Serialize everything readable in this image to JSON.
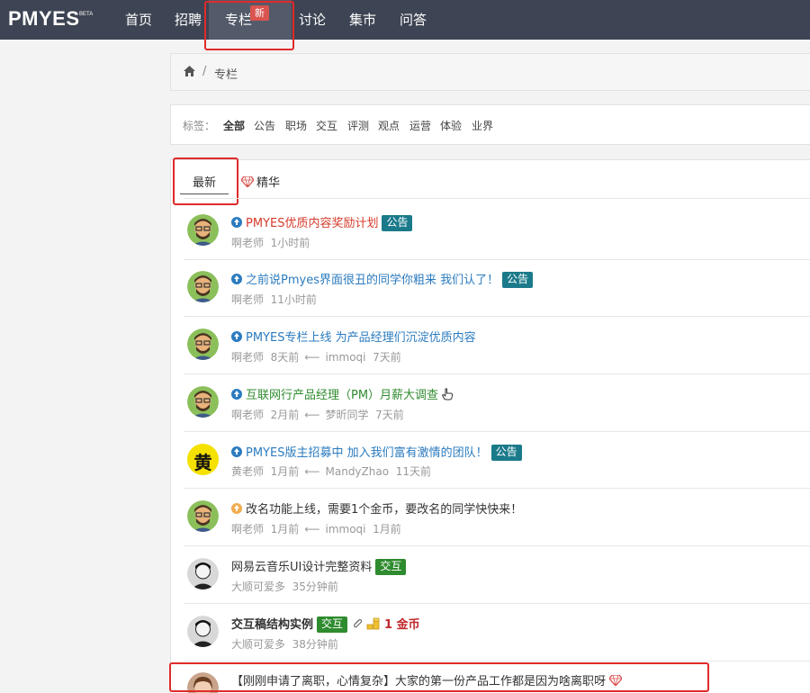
{
  "nav": {
    "logo": "PMYES",
    "logo_badge": "BETA",
    "items": [
      "首页",
      "招聘",
      "专栏",
      "讨论",
      "集市",
      "问答"
    ],
    "active": "专栏",
    "new_badge": "新"
  },
  "breadcrumb": {
    "separator": "/",
    "current": "专栏"
  },
  "tags": {
    "label": "标签：",
    "items": [
      "全部",
      "公告",
      "职场",
      "交互",
      "评测",
      "观点",
      "运营",
      "体验",
      "业界"
    ],
    "active": "全部"
  },
  "tabs": {
    "latest": "最新",
    "featured": "精华"
  },
  "colors": {
    "nav_bg": "#3d4453",
    "announce_badge": "#1a7a8a",
    "interaction_badge": "#2e8b2e",
    "highlight_box": "#e02a2a"
  },
  "posts": [
    {
      "title": "PMYES优质内容奖励计划",
      "badge": "公告",
      "author": "啊老师",
      "time": "1小时前",
      "avatar_icon": "bearded-man-avatar"
    },
    {
      "title": "之前说Pmyes界面很丑的同学你粗来 我们认了！",
      "badge": "公告",
      "author": "啊老师",
      "time": "11小时前",
      "avatar_icon": "bearded-man-avatar"
    },
    {
      "title": "PMYES专栏上线 为产品经理们沉淀优质内容",
      "author": "啊老师",
      "time": "8天前",
      "arrow": "⟵",
      "reply_author": "immoqi",
      "reply_time": "7天前",
      "avatar_icon": "bearded-man-avatar"
    },
    {
      "title": "互联网行产品经理（PM）月薪大调查",
      "author": "啊老师",
      "time": "2月前",
      "arrow": "⟵",
      "reply_author": "梦昕同学",
      "reply_time": "7天前",
      "avatar_icon": "bearded-man-avatar"
    },
    {
      "title": "PMYES版主招募中 加入我们富有激情的团队！",
      "badge": "公告",
      "author": "黄老师",
      "time": "1月前",
      "arrow": "⟵",
      "reply_author": "MandyZhao",
      "reply_time": "11天前",
      "avatar_icon": "huang-character-avatar",
      "avatar_char": "黄"
    },
    {
      "title": "改名功能上线，需要1个金币，要改名的同学快快来！",
      "author": "啊老师",
      "time": "1月前",
      "arrow": "⟵",
      "reply_author": "immoqi",
      "reply_time": "1月前",
      "avatar_icon": "bearded-man-avatar"
    },
    {
      "title": "网易云音乐UI设计完整资料",
      "badge": "交互",
      "author": "大顺可爱多",
      "time": "35分钟前",
      "avatar_icon": "sketch-man-avatar"
    },
    {
      "title": "交互稿结构实例",
      "badge": "交互",
      "reward": "1 金币",
      "author": "大顺可爱多",
      "time": "38分钟前",
      "avatar_icon": "sketch-man-avatar"
    },
    {
      "title": "【刚刚申请了离职，心情复杂】大家的第一份产品工作都是因为啥离职呀",
      "avatar_icon": "woman-avatar"
    }
  ]
}
